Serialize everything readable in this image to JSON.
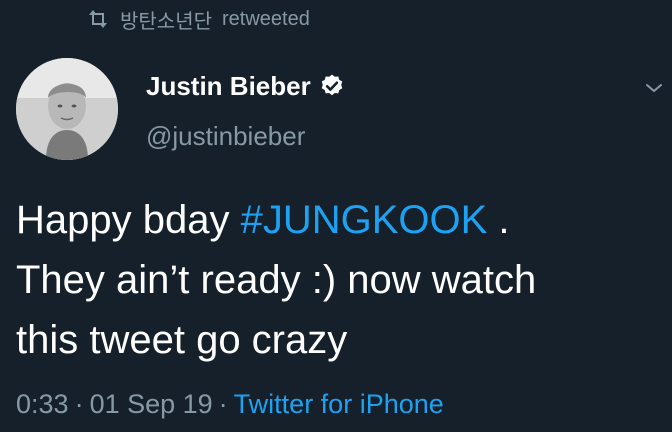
{
  "retweet": {
    "retweeter": "방탄소년단",
    "suffix": "retweeted",
    "icon": "retweet-icon"
  },
  "author": {
    "name": "Justin Bieber",
    "handle": "@justinbieber",
    "verified": true,
    "verified_icon": "verified-badge-icon",
    "avatar": "author-avatar"
  },
  "tweet": {
    "line1_before": "Happy bday ",
    "hashtag": "#JUNGKOOK",
    "line1_after": " .",
    "line2": "They ain’t ready :) now watch",
    "line3": "this tweet go crazy"
  },
  "meta": {
    "time": "0:33",
    "separator": "·",
    "date": "01 Sep 19",
    "source": "Twitter for iPhone"
  },
  "menu": {
    "icon": "chevron-down-icon"
  },
  "colors": {
    "background": "#15202b",
    "text": "#ffffff",
    "secondary": "#8899a6",
    "accent": "#1da1f2"
  }
}
